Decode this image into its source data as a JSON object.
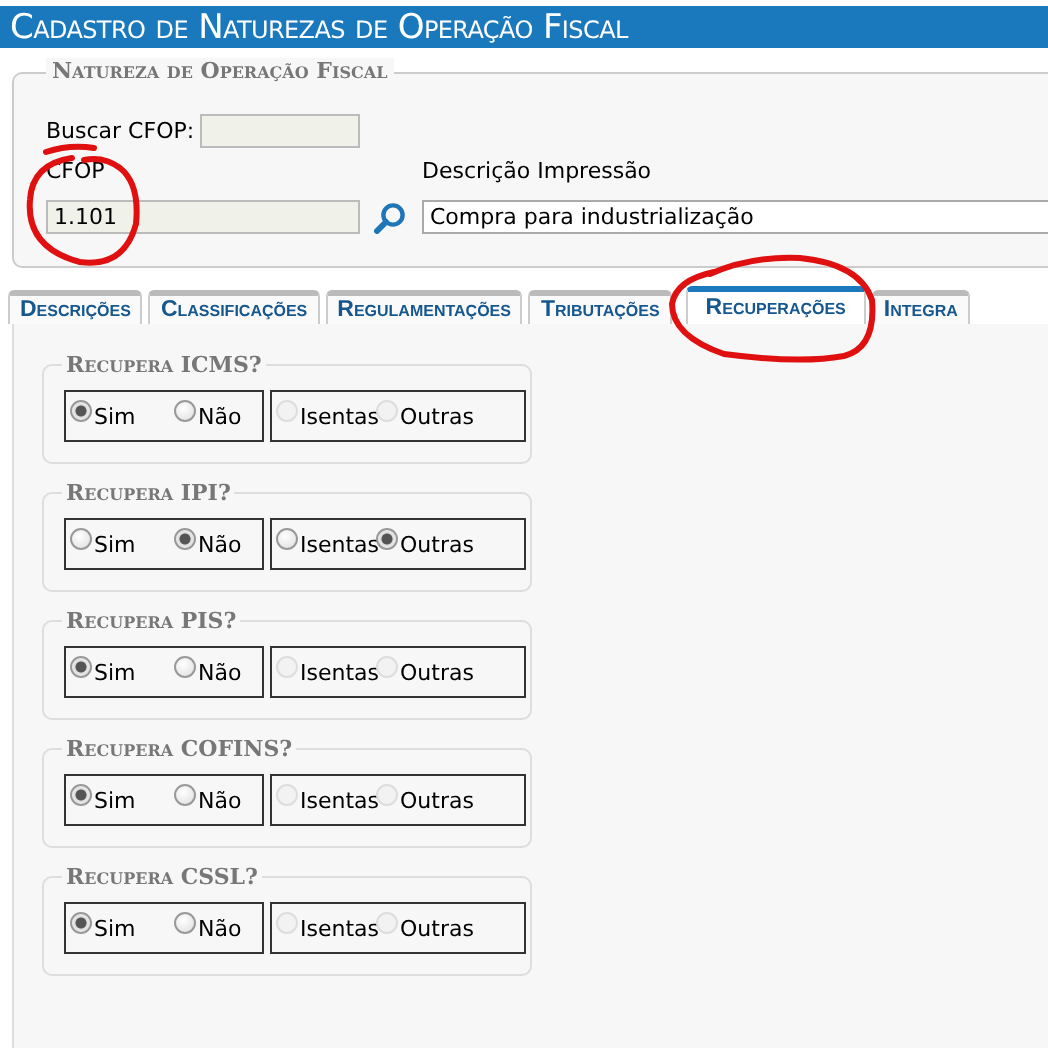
{
  "window": {
    "title": "Cadastro de Naturezas de Operação Fiscal"
  },
  "fieldset": {
    "legend": "Natureza de Operação Fiscal",
    "search_label": "Buscar CFOP:",
    "cfop_label": "CFOP",
    "cfop_value": "1.101",
    "description_label": "Descrição Impressão",
    "description_value": "Compra para industrialização"
  },
  "tabs": [
    {
      "label": "Descrições",
      "selected": false
    },
    {
      "label": "Classificações",
      "selected": false
    },
    {
      "label": "Regulamentações",
      "selected": false
    },
    {
      "label": "Tributações",
      "selected": false
    },
    {
      "label": "Recuperações",
      "selected": true
    },
    {
      "label": "Integra",
      "selected": false
    }
  ],
  "sections": [
    {
      "title": "Recupera ICMS?",
      "groups": [
        [
          {
            "label": "Sim",
            "selected": true,
            "disabled": false
          },
          {
            "label": "Não",
            "selected": false,
            "disabled": false
          }
        ],
        [
          {
            "label": "Isentas",
            "selected": false,
            "disabled": true
          },
          {
            "label": "Outras",
            "selected": false,
            "disabled": true
          }
        ]
      ]
    },
    {
      "title": "Recupera IPI?",
      "groups": [
        [
          {
            "label": "Sim",
            "selected": false,
            "disabled": false
          },
          {
            "label": "Não",
            "selected": true,
            "disabled": false
          }
        ],
        [
          {
            "label": "Isentas",
            "selected": false,
            "disabled": false
          },
          {
            "label": "Outras",
            "selected": true,
            "disabled": false
          }
        ]
      ]
    },
    {
      "title": "Recupera PIS?",
      "groups": [
        [
          {
            "label": "Sim",
            "selected": true,
            "disabled": false
          },
          {
            "label": "Não",
            "selected": false,
            "disabled": false
          }
        ],
        [
          {
            "label": "Isentas",
            "selected": false,
            "disabled": true
          },
          {
            "label": "Outras",
            "selected": false,
            "disabled": true
          }
        ]
      ]
    },
    {
      "title": "Recupera COFINS?",
      "groups": [
        [
          {
            "label": "Sim",
            "selected": true,
            "disabled": false
          },
          {
            "label": "Não",
            "selected": false,
            "disabled": false
          }
        ],
        [
          {
            "label": "Isentas",
            "selected": false,
            "disabled": true
          },
          {
            "label": "Outras",
            "selected": false,
            "disabled": true
          }
        ]
      ]
    },
    {
      "title": "Recupera CSSL?",
      "groups": [
        [
          {
            "label": "Sim",
            "selected": true,
            "disabled": false
          },
          {
            "label": "Não",
            "selected": false,
            "disabled": false
          }
        ],
        [
          {
            "label": "Isentas",
            "selected": false,
            "disabled": true
          },
          {
            "label": "Outras",
            "selected": false,
            "disabled": true
          }
        ]
      ]
    }
  ]
}
